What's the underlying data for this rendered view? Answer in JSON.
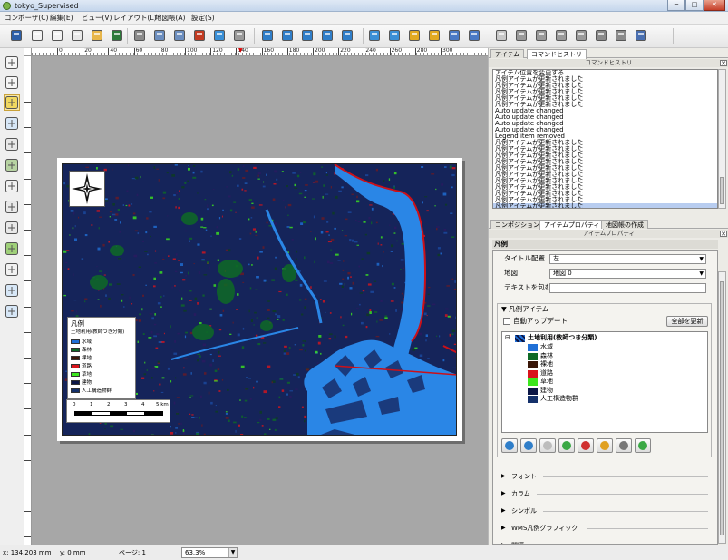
{
  "window": {
    "title": "tokyo_Supervised",
    "minimize": "─",
    "maximize": "□",
    "close": "✕"
  },
  "menu": [
    "コンポーザ(C)",
    "編集(E)",
    "ビュー(V)",
    "レイアウト(L)",
    "地図帳(A)",
    "設定(S)"
  ],
  "toolbar": {
    "icons": [
      "save-icon",
      "new-composer-icon",
      "duplicate-composer-icon",
      "composer-manager-icon",
      "open-folder-icon",
      "save-template-icon",
      "print-icon",
      "export-image-icon",
      "export-svg-icon",
      "export-pdf-icon",
      "undo-icon",
      "redo-icon",
      "zoom-full-icon",
      "zoom-100-icon",
      "zoom-in-icon",
      "zoom-out-icon",
      "refresh-icon",
      "group-icon",
      "ungroup-icon",
      "lock-icon",
      "unlock-icon",
      "raise-icon",
      "align-icon",
      "atlas-preview-icon",
      "first-feature-icon",
      "prev-feature-icon",
      "next-feature-icon",
      "last-feature-icon",
      "atlas-print-icon",
      "atlas-export-icon",
      "atlas-settings-icon"
    ]
  },
  "left_tools": [
    "pan-icon",
    "zoom-tool-icon",
    "select-move-icon",
    "move-content-icon",
    "add-map-icon",
    "add-image-icon",
    "add-label-icon",
    "add-legend-icon",
    "add-scalebar-icon",
    "add-shape-icon",
    "add-arrow-icon",
    "add-table-icon",
    "add-html-icon"
  ],
  "ruler": {
    "h_labels": [
      "0",
      "20",
      "40",
      "60",
      "80",
      "100",
      "120",
      "140",
      "160",
      "180",
      "200",
      "220",
      "240",
      "260",
      "280",
      "300"
    ],
    "marker": "▼"
  },
  "map_layout": {
    "legend": {
      "title": "凡例",
      "subtitle": "土地利用(教師つき分類)",
      "items": [
        {
          "label": "水域",
          "color": "#1f6fd6"
        },
        {
          "label": "森林",
          "color": "#0e6a26"
        },
        {
          "label": "裸地",
          "color": "#3a1608"
        },
        {
          "label": "道路",
          "color": "#d8141c"
        },
        {
          "label": "草地",
          "color": "#3ce61e"
        },
        {
          "label": "建物",
          "color": "#0b1646"
        },
        {
          "label": "人工構造物群",
          "color": "#14306a"
        }
      ]
    },
    "scalebar": {
      "labels": [
        "0",
        "1",
        "2",
        "3",
        "4",
        "5 km"
      ]
    }
  },
  "right_panel": {
    "tabs_top": [
      "アイテム",
      "コマンドヒストリ"
    ],
    "history_header": "コマンドヒストリ",
    "history": [
      "アイテム位置を変更する",
      "凡例アイテムが更新されました",
      "凡例アイテムが更新されました",
      "凡例アイテムが更新されました",
      "凡例アイテムが更新されました",
      "凡例アイテムが更新されました",
      "Auto update changed",
      "Auto update changed",
      "Auto update changed",
      "Auto update changed",
      "Legend item removed",
      "凡例アイテムが更新されました",
      "凡例アイテムが更新されました",
      "凡例アイテムが更新されました",
      "凡例アイテムが更新されました",
      "凡例アイテムが更新されました",
      "凡例アイテムが更新されました",
      "凡例アイテムが更新されました",
      "凡例アイテムが更新されました",
      "凡例アイテムが更新されました",
      "凡例アイテムが更新されました",
      "凡例アイテムが更新されました"
    ],
    "tabs_bottom": [
      "コンポジション",
      "アイテムプロパティ",
      "地図帳の作成"
    ],
    "props_header": "アイテムプロパティ",
    "legend_section": "凡例",
    "title_align_label": "タイトル配置",
    "title_align_value": "左",
    "map_label": "地図",
    "map_value": "地図 0",
    "wrap_label": "テキストを包む",
    "wrap_value": "",
    "items_group": "凡例アイテム",
    "auto_update_label": "自動アップデート",
    "update_all_button": "全部を更新",
    "tree_layer": "土地利用(教師つき分類)",
    "tree_classes": [
      {
        "label": "水域",
        "color": "#1f6fd6"
      },
      {
        "label": "森林",
        "color": "#0e6a26"
      },
      {
        "label": "裸地",
        "color": "#3a1608"
      },
      {
        "label": "道路",
        "color": "#d8141c"
      },
      {
        "label": "草地",
        "color": "#3ce61e"
      },
      {
        "label": "建物",
        "color": "#0b1646"
      },
      {
        "label": "人工構造物群",
        "color": "#14306a"
      }
    ],
    "tree_buttons": [
      "move-down-icon",
      "move-up-icon",
      "add-group-icon",
      "add-item-icon",
      "remove-item-icon",
      "edit-item-icon",
      "sum-icon",
      "filter-icon"
    ],
    "collapsed": [
      "フォント",
      "カラム",
      "シンボル",
      "WMS凡例グラフィック",
      "間隔"
    ]
  },
  "status": {
    "x": "x: 134.203 mm",
    "y": "y: 0 mm",
    "page": "ページ: 1",
    "zoom": "63.3%"
  }
}
